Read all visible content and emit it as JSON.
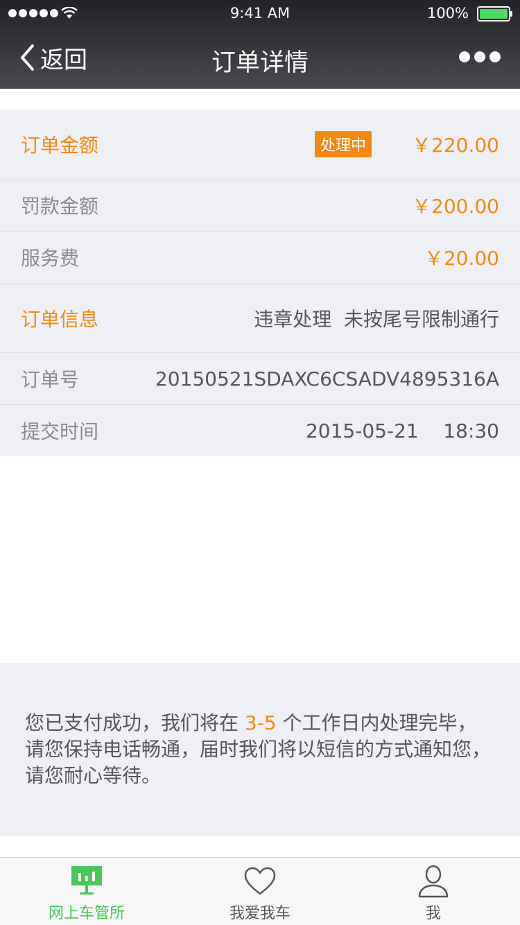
{
  "status_bar": {
    "time": "9:41 AM",
    "battery": "100%"
  },
  "nav": {
    "back_label": "返回",
    "title": "订单详情"
  },
  "order_amount": {
    "label": "订单金额",
    "status": "处理中",
    "value": "￥220.00"
  },
  "fine_amount": {
    "label": "罚款金额",
    "value": "￥200.00"
  },
  "service_fee": {
    "label": "服务费",
    "value": "￥20.00"
  },
  "order_info": {
    "label": "订单信息",
    "value": "违章处理  未按尾号限制通行"
  },
  "order_number": {
    "label": "订单号",
    "value": "20150521SDAXC6CSADV4895316A"
  },
  "submit_time": {
    "label": "提交时间",
    "value": "2015-05-21    18:30"
  },
  "notice": {
    "text_before": "您已支付成功，我们将在 ",
    "highlight": "3-5",
    "text_after": " 个工作日内处理完毕，请您保持电话畅通，届时我们将以短信的方式通知您，请您耐心等待。"
  },
  "tabs": [
    {
      "label": "网上车管所",
      "icon": "chart-board-icon",
      "active": true
    },
    {
      "label": "我爱我车",
      "icon": "heart-icon",
      "active": false
    },
    {
      "label": "我",
      "icon": "person-icon",
      "active": false
    }
  ],
  "colors": {
    "accent": "#f5890f",
    "active_tab": "#49c85a",
    "row_bg": "#eef0f5",
    "header_dark": "#222327"
  }
}
